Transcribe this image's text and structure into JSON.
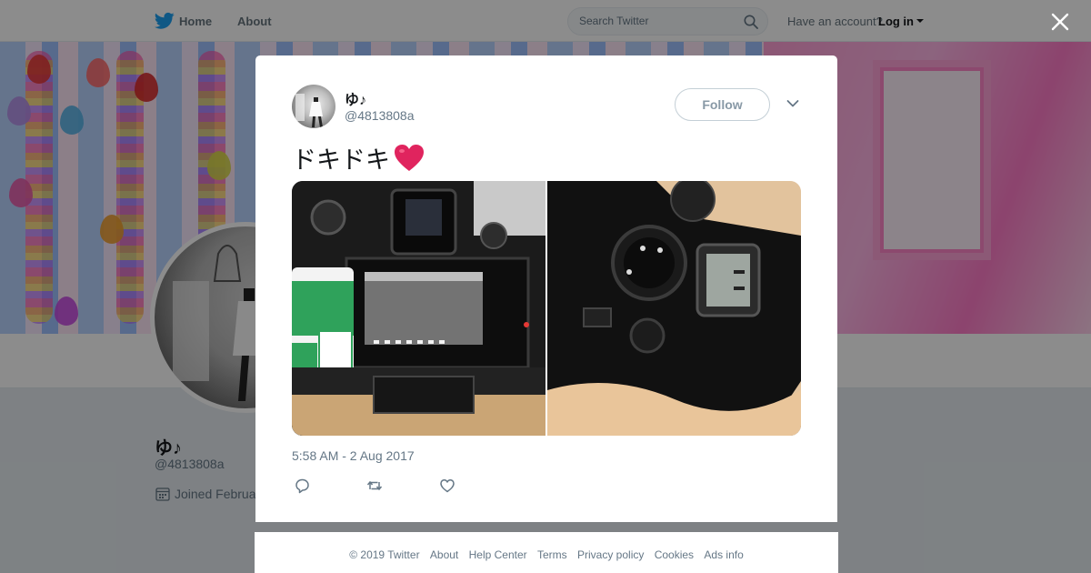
{
  "nav": {
    "home": "Home",
    "about": "About",
    "search_placeholder": "Search Twitter",
    "have_account": "Have an account?",
    "login": "Log in"
  },
  "profile": {
    "name": "ゆ♪",
    "handle": "@4813808a",
    "joined": "Joined Februa"
  },
  "tweet": {
    "name": "ゆ♪",
    "handle": "@4813808a",
    "follow_label": "Follow",
    "text": "ドキドキ",
    "timestamp": "5:58 AM - 2 Aug 2017"
  },
  "icons": [
    "twitter-bird-icon",
    "search-icon",
    "caret-down-icon",
    "calendar-icon",
    "close-icon",
    "chevron-down-icon",
    "heart-emoji",
    "reply-icon",
    "retweet-icon",
    "like-icon"
  ],
  "colors": {
    "brand": "#1da1f2",
    "muted": "#657786",
    "heart_emoji": "#e0245e"
  },
  "footer": {
    "links": [
      "© 2019 Twitter",
      "About",
      "Help Center",
      "Terms",
      "Privacy policy",
      "Cookies",
      "Ads info"
    ]
  }
}
